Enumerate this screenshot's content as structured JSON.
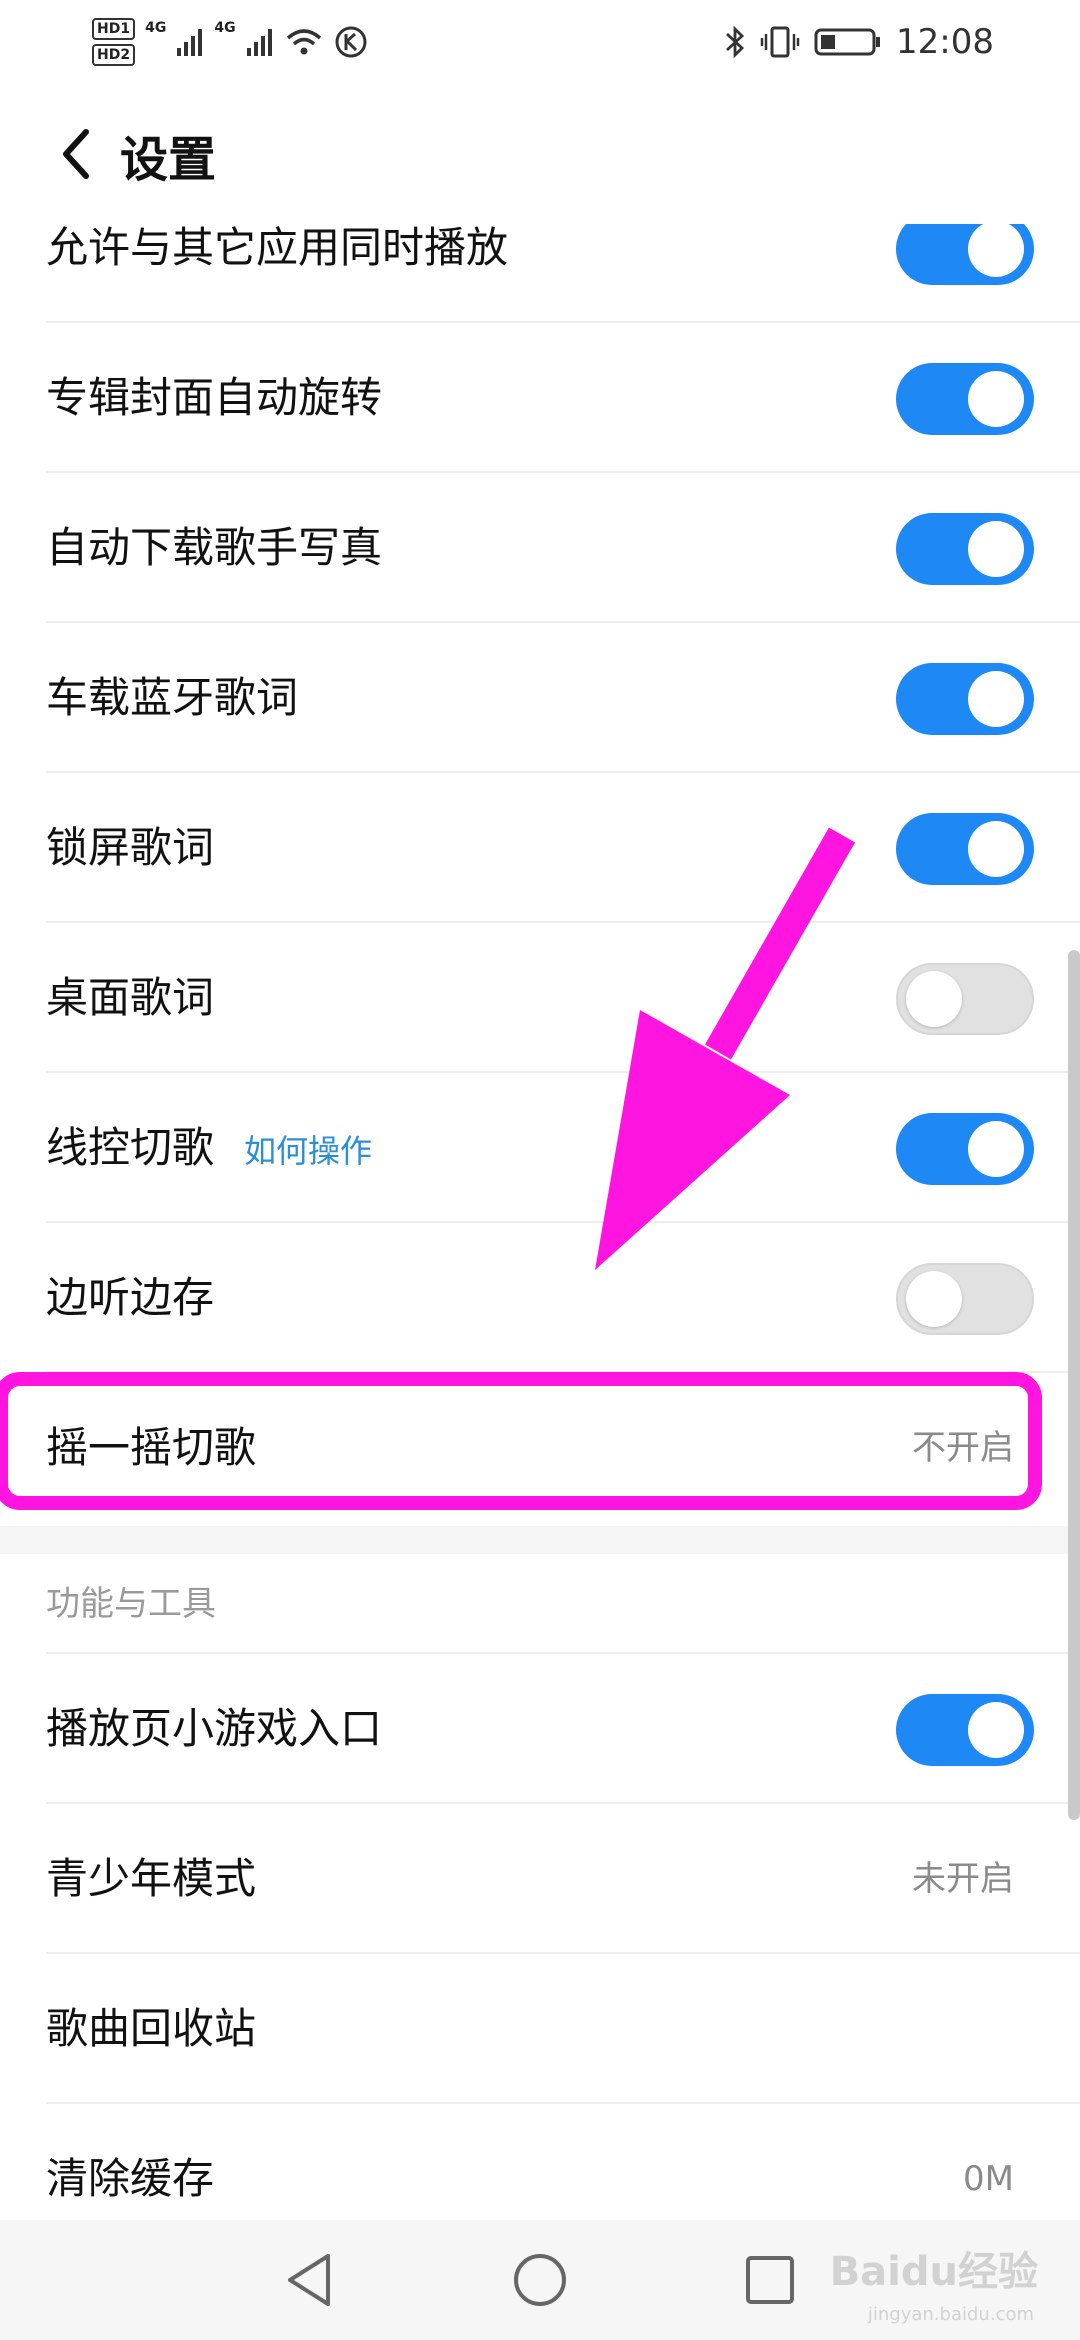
{
  "status_bar": {
    "time": "12:08",
    "hd1": "HD1",
    "hd2": "HD2",
    "net1": "4G",
    "net2": "4G",
    "icons": [
      "signal-icon",
      "signal-icon",
      "wifi-icon",
      "k-app-icon",
      "bluetooth-icon",
      "vibrate-icon",
      "battery-icon"
    ]
  },
  "header": {
    "title": "设置",
    "back_icon": "chevron-left-icon"
  },
  "rows": [
    {
      "label": "允许与其它应用同时播放",
      "toggle": true
    },
    {
      "label": "专辑封面自动旋转",
      "toggle": true
    },
    {
      "label": "自动下载歌手写真",
      "toggle": true
    },
    {
      "label": "车载蓝牙歌词",
      "toggle": true
    },
    {
      "label": "锁屏歌词",
      "toggle": true
    },
    {
      "label": "桌面歌词",
      "toggle": false
    },
    {
      "label": "线控切歌",
      "help": "如何操作",
      "toggle": true
    },
    {
      "label": "边听边存",
      "toggle": false
    },
    {
      "label": "摇一摇切歌",
      "value": "不开启"
    }
  ],
  "section": {
    "title": "功能与工具"
  },
  "tools_rows": [
    {
      "label": "播放页小游戏入口",
      "toggle": true
    },
    {
      "label": "青少年模式",
      "value": "未开启"
    },
    {
      "label": "歌曲回收站"
    },
    {
      "label": "清除缓存",
      "value": "0M"
    }
  ],
  "watermark": {
    "brand": "Baidu经验",
    "url": "jingyan.baidu.com"
  },
  "colors": {
    "accent": "#1e88f5",
    "annotation": "#ff14e0",
    "toggle_off": "#e1e1e1"
  }
}
